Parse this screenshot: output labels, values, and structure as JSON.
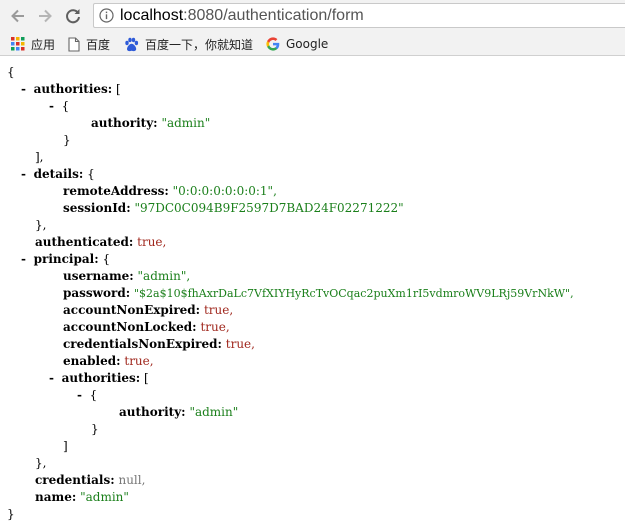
{
  "browser": {
    "url_host": "localhost",
    "url_rest": ":8080/authentication/form"
  },
  "bookmarks": [
    {
      "label": "应用"
    },
    {
      "label": "百度"
    },
    {
      "label": "百度一下，你就知道"
    },
    {
      "label": "Google"
    }
  ],
  "json_view": {
    "open_brace": "{",
    "close_brace": "}",
    "open_bracket": "[",
    "close_bracket": "]",
    "close_brace_comma": "},",
    "close_bracket_comma": "],",
    "collapse_symbol": "-",
    "authorities_key": "authorities:",
    "authority_key": "authority:",
    "authority_value": "\"admin\"",
    "details_key": "details:",
    "remote_address_key": "remoteAddress:",
    "remote_address_value": "\"0:0:0:0:0:0:0:1\",",
    "session_id_key": "sessionId:",
    "session_id_value": "\"97DC0C094B9F2597D7BAD24F02271222\"",
    "authenticated_key": "authenticated:",
    "authenticated_value": "true,",
    "principal_key": "principal:",
    "username_key": "username:",
    "username_value": "\"admin\",",
    "password_key": "password:",
    "password_value": "\"$2a$10$fhAxrDaLc7VfXIYHyRcTvOCqac2puXm1rI5vdmroWV9LRj59VrNkW\",",
    "account_non_expired_key": "accountNonExpired:",
    "account_non_expired_value": "true,",
    "account_non_locked_key": "accountNonLocked:",
    "account_non_locked_value": "true,",
    "credentials_non_expired_key": "credentialsNonExpired:",
    "credentials_non_expired_value": "true,",
    "enabled_key": "enabled:",
    "enabled_value": "true,",
    "credentials_key": "credentials:",
    "credentials_value": "null,",
    "name_key": "name:",
    "name_value": "\"admin\""
  }
}
